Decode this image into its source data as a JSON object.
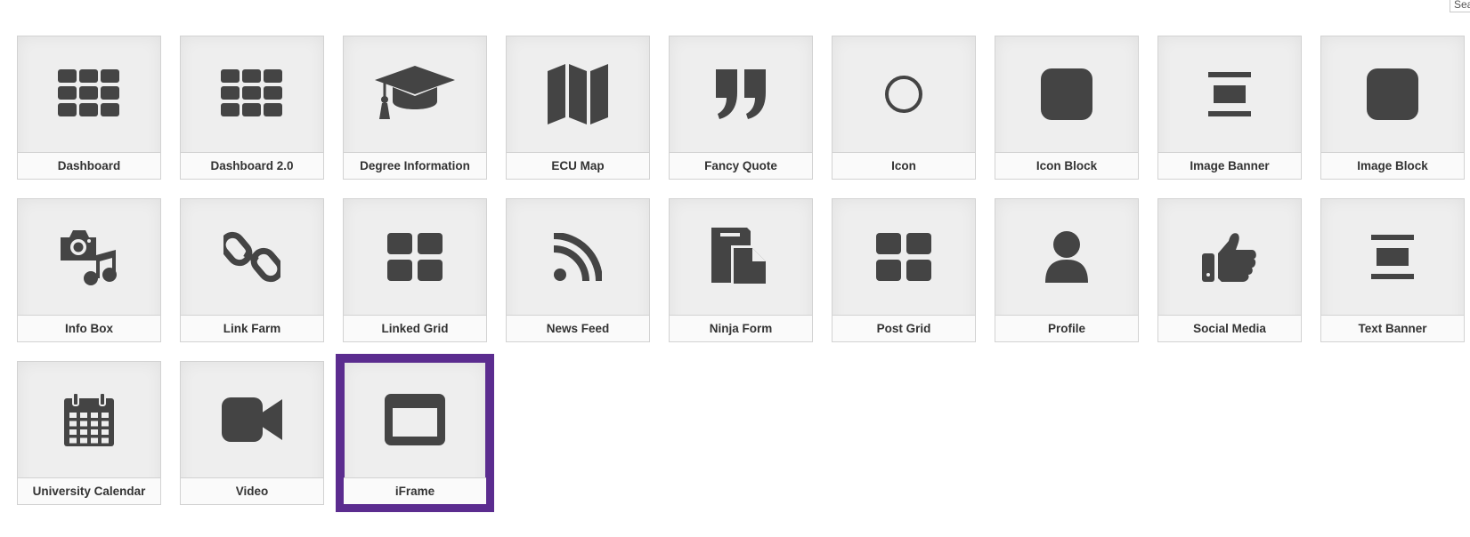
{
  "search": {
    "placeholder": "Sea"
  },
  "accent_color": "#5b2c8f",
  "icon_color": "#444444",
  "tiles": [
    {
      "label": "Dashboard",
      "icon": "grid-icon"
    },
    {
      "label": "Dashboard 2.0",
      "icon": "grid-icon"
    },
    {
      "label": "Degree Information",
      "icon": "graduation-cap-icon"
    },
    {
      "label": "ECU Map",
      "icon": "map-icon"
    },
    {
      "label": "Fancy Quote",
      "icon": "quote-icon"
    },
    {
      "label": "Icon",
      "icon": "circle-outline-icon"
    },
    {
      "label": "Icon Block",
      "icon": "rounded-square-icon"
    },
    {
      "label": "Image Banner",
      "icon": "banner-icon"
    },
    {
      "label": "Image Block",
      "icon": "rounded-square-icon"
    },
    {
      "label": "Info Box",
      "icon": "camera-music-icon"
    },
    {
      "label": "Link Farm",
      "icon": "chain-link-icon"
    },
    {
      "label": "Linked Grid",
      "icon": "four-squares-icon"
    },
    {
      "label": "News Feed",
      "icon": "rss-icon"
    },
    {
      "label": "Ninja Form",
      "icon": "documents-icon"
    },
    {
      "label": "Post Grid",
      "icon": "four-squares-icon"
    },
    {
      "label": "Profile",
      "icon": "user-icon"
    },
    {
      "label": "Social Media",
      "icon": "thumbs-up-icon"
    },
    {
      "label": "Text Banner",
      "icon": "banner-icon"
    },
    {
      "label": "University Calendar",
      "icon": "calendar-icon"
    },
    {
      "label": "Video",
      "icon": "video-camera-icon"
    },
    {
      "label": "iFrame",
      "icon": "window-icon",
      "selected": true
    }
  ]
}
